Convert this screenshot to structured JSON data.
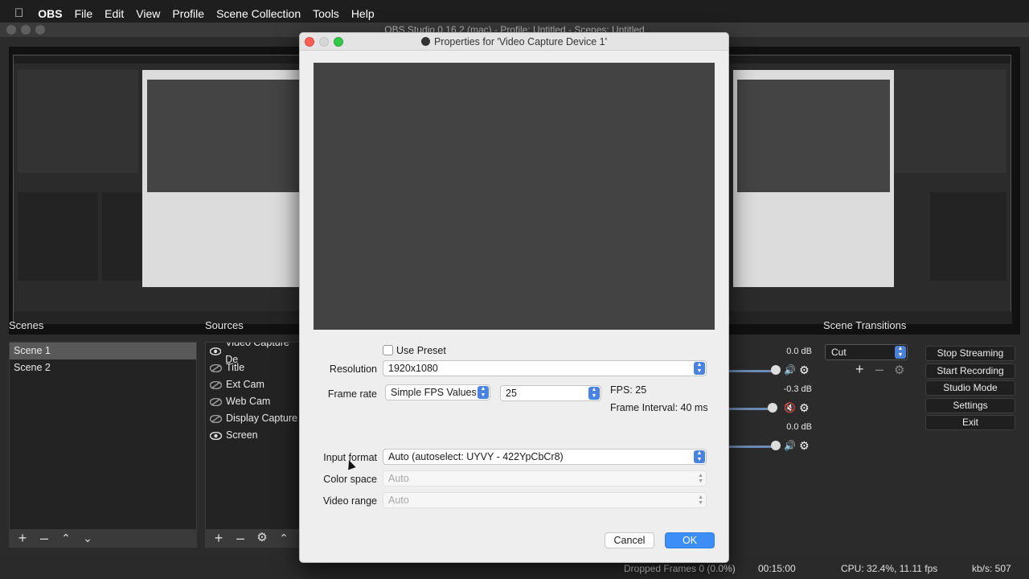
{
  "menubar": {
    "app": "OBS",
    "items": [
      "File",
      "Edit",
      "View",
      "Profile",
      "Scene Collection",
      "Tools",
      "Help"
    ]
  },
  "window": {
    "title": "OBS Studio 0.16.2 (mac) - Profile: Untitled - Scenes: Untitled"
  },
  "scenes": {
    "title": "Scenes",
    "items": [
      "Scene 1",
      "Scene 2"
    ],
    "selected": 0
  },
  "sources": {
    "title": "Sources",
    "items": [
      "Video Capture De",
      "Title",
      "Ext Cam",
      "Web Cam",
      "Display Capture",
      "Screen"
    ]
  },
  "mixer": {
    "levels": [
      "0.0 dB",
      "-0.3 dB",
      "0.0 dB"
    ]
  },
  "transitions": {
    "title": "Scene Transitions",
    "selected": "Cut"
  },
  "controls": {
    "stop_streaming": "Stop Streaming",
    "start_recording": "Start Recording",
    "studio_mode": "Studio Mode",
    "settings": "Settings",
    "exit": "Exit"
  },
  "status": {
    "dropped": "Dropped Frames 0 (0.0%)",
    "time": "00:15:00",
    "cpu": "CPU: 32.4%, 11.11 fps",
    "kbs": "kb/s: 507"
  },
  "dialog": {
    "title": "Properties for 'Video Capture Device 1'",
    "use_preset": "Use Preset",
    "resolution_label": "Resolution",
    "resolution_value": "1920x1080",
    "frame_rate_label": "Frame rate",
    "frame_rate_mode": "Simple FPS Values",
    "frame_rate_value": "25",
    "fps_text": "FPS: 25",
    "frame_interval": "Frame Interval: 40 ms",
    "input_format_label": "Input format",
    "input_format_value": "Auto (autoselect: UYVY - 422YpCbCr8)",
    "color_space_label": "Color space",
    "color_space_value": "Auto",
    "video_range_label": "Video range",
    "video_range_value": "Auto",
    "cancel": "Cancel",
    "ok": "OK"
  },
  "colors": {
    "accent_blue": "#3e8ef7",
    "select_arrow_blue": "#4a82e0",
    "mute_red": "#d9302c"
  }
}
